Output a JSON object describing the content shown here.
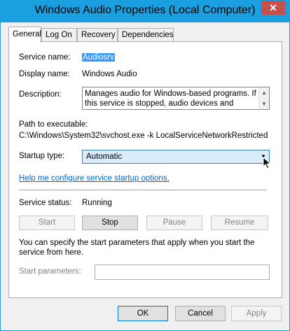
{
  "window": {
    "title": "Windows Audio Properties (Local Computer)",
    "close_glyph": "✕"
  },
  "tabs": [
    {
      "label": "General"
    },
    {
      "label": "Log On"
    },
    {
      "label": "Recovery"
    },
    {
      "label": "Dependencies"
    }
  ],
  "general": {
    "service_name_label": "Service name:",
    "service_name_value": "Audiosrv",
    "display_name_label": "Display name:",
    "display_name_value": "Windows Audio",
    "description_label": "Description:",
    "description_value": "Manages audio for Windows-based programs.  If this service is stopped, audio devices and effects will not",
    "path_label": "Path to executable:",
    "path_value": "C:\\Windows\\System32\\svchost.exe -k LocalServiceNetworkRestricted",
    "startup_type_label": "Startup type:",
    "startup_type_value": "Automatic",
    "help_link": "Help me configure service startup options.",
    "service_status_label": "Service status:",
    "service_status_value": "Running",
    "buttons": {
      "start": "Start",
      "stop": "Stop",
      "pause": "Pause",
      "resume": "Resume"
    },
    "help_text": "You can specify the start parameters that apply when you start the service from here.",
    "start_params_label": "Start parameters:",
    "start_params_value": ""
  },
  "footer": {
    "ok": "OK",
    "cancel": "Cancel",
    "apply": "Apply"
  },
  "colors": {
    "titlebar": "#1a9fe0",
    "close": "#c7504a",
    "selection": "#3399ff",
    "link": "#0066cc"
  },
  "icons": {
    "scroll_up": "▲",
    "scroll_down": "▼",
    "dropdown": "▼"
  }
}
